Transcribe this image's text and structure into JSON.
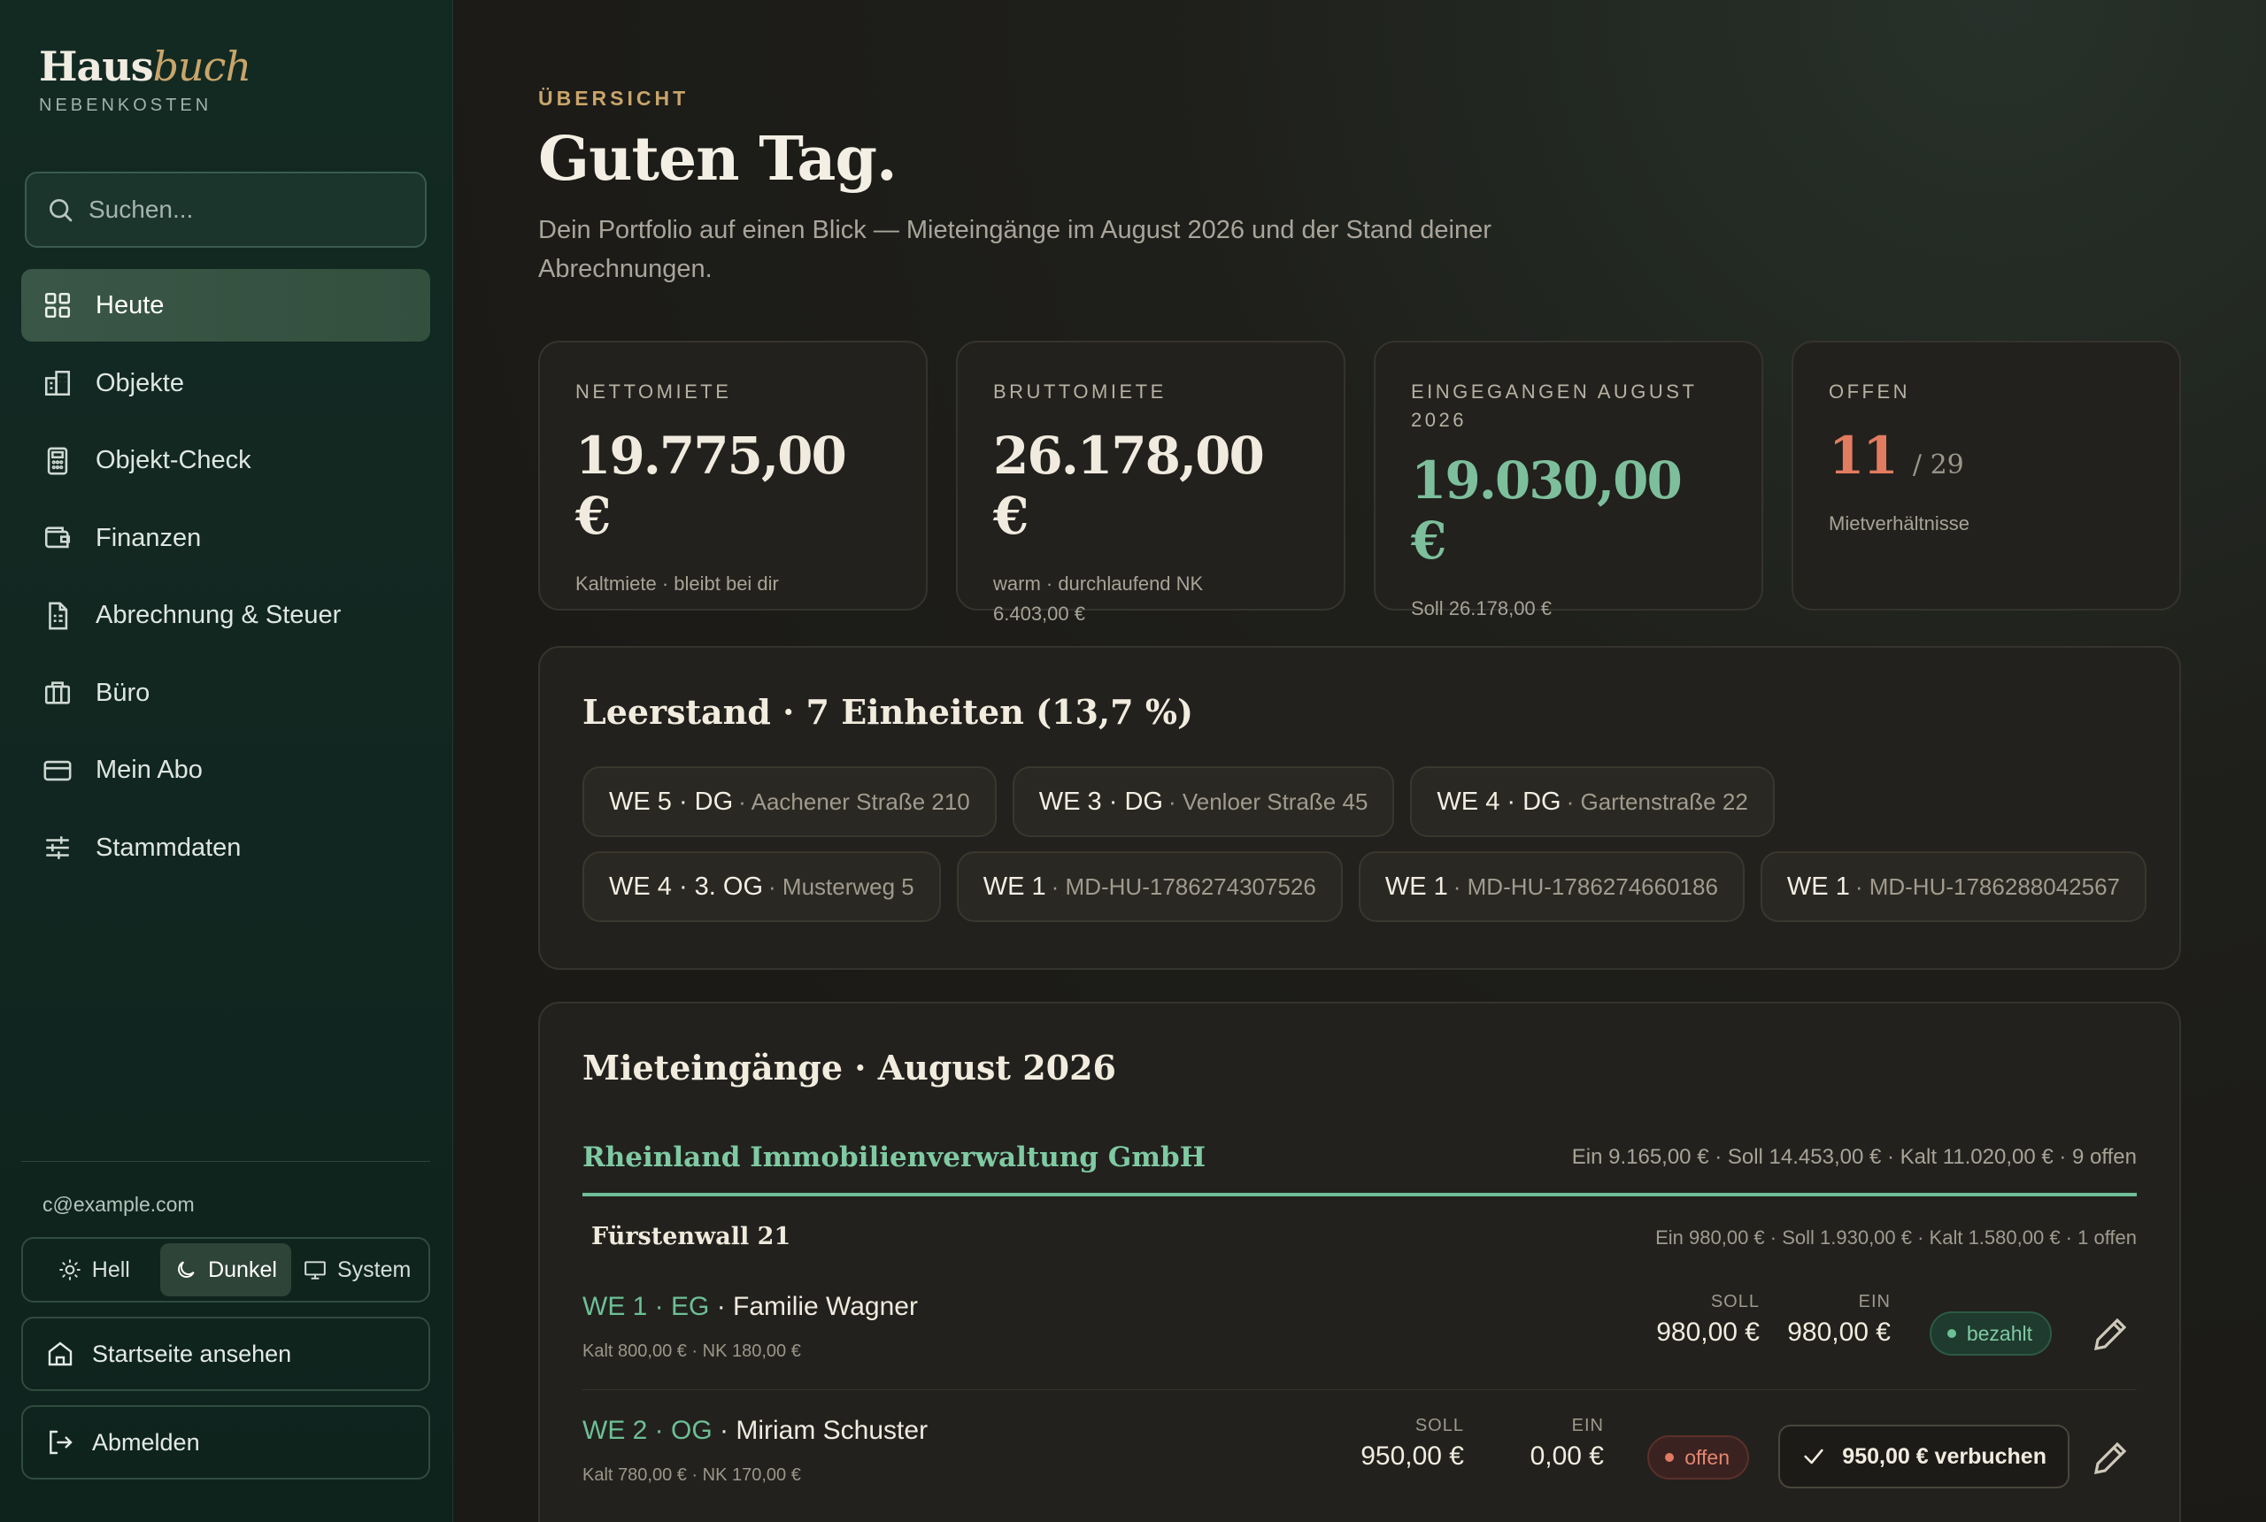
{
  "brand": {
    "title_main": "Haus",
    "title_accent": "buch",
    "subtitle": "NEBENKOSTEN"
  },
  "search": {
    "placeholder": "Suchen..."
  },
  "nav": [
    {
      "label": "Heute",
      "icon": "grid-icon",
      "active": true
    },
    {
      "label": "Objekte",
      "icon": "building-icon"
    },
    {
      "label": "Objekt-Check",
      "icon": "calculator-icon"
    },
    {
      "label": "Finanzen",
      "icon": "wallet-icon"
    },
    {
      "label": "Abrechnung & Steuer",
      "icon": "document-icon"
    },
    {
      "label": "Büro",
      "icon": "briefcase-icon"
    },
    {
      "label": "Mein Abo",
      "icon": "credit-card-icon"
    },
    {
      "label": "Stammdaten",
      "icon": "sliders-icon"
    }
  ],
  "user": {
    "email": "c@example.com"
  },
  "theme": {
    "light": "Hell",
    "dark": "Dunkel",
    "system": "System",
    "selected": "Dunkel"
  },
  "sidebar_actions": {
    "home": "Startseite ansehen",
    "logout": "Abmelden"
  },
  "header": {
    "eyebrow": "ÜBERSICHT",
    "title": "Guten Tag.",
    "lead": "Dein Portfolio auf einen Blick — Mieteingänge im August 2026 und der Stand deiner Abrechnungen."
  },
  "kpis": [
    {
      "label": "NETTOMIETE",
      "value": "19.775,00 €",
      "note": "Kaltmiete · bleibt bei dir"
    },
    {
      "label": "BRUTTOMIETE",
      "value": "26.178,00 €",
      "note": "warm · durchlaufend NK 6.403,00 €"
    },
    {
      "label": "EINGEGANGEN AUGUST 2026",
      "value": "19.030,00 €",
      "note": "Soll 26.178,00 €"
    },
    {
      "label": "OFFEN",
      "value": "11",
      "value_suffix": "/ 29",
      "note": "Mietverhältnisse"
    }
  ],
  "vacancy": {
    "title": "Leerstand · 7 Einheiten (13,7 %)",
    "chips": [
      {
        "unit": "WE 5 · DG",
        "addr": "· Aachener Straße 210"
      },
      {
        "unit": "WE 3 · DG",
        "addr": "· Venloer Straße 45"
      },
      {
        "unit": "WE 4 · DG",
        "addr": "· Gartenstraße 22"
      },
      {
        "unit": "WE 4 · 3. OG",
        "addr": "· Musterweg 5"
      },
      {
        "unit": "WE 1",
        "addr": "· MD-HU-1786274307526"
      },
      {
        "unit": "WE 1",
        "addr": "· MD-HU-1786274660186"
      },
      {
        "unit": "WE 1",
        "addr": "· MD-HU-1786288042567"
      }
    ]
  },
  "income": {
    "title": "Mieteingänge · August 2026",
    "landlord": {
      "name": "Rheinland Immobilienverwaltung GmbH",
      "stats": "Ein 9.165,00 € · Soll 14.453,00 € · Kalt 11.020,00 € · 9 offen"
    },
    "property": {
      "name": "Fürstenwall 21",
      "stats": "Ein 980,00 € · Soll 1.930,00 € · Kalt 1.580,00 € · 1 offen"
    },
    "labels": {
      "soll": "SOLL",
      "ein": "EIN"
    },
    "rows": [
      {
        "we": "WE 1 · EG",
        "tenant": "· Familie Wagner",
        "sub": "Kalt 800,00 € · NK 180,00 €",
        "soll": "980,00 €",
        "ein": "980,00 €",
        "status": "bezahlt"
      },
      {
        "we": "WE 2 · OG",
        "tenant": "· Miriam Schuster",
        "sub": "Kalt 780,00 € · NK 170,00 €",
        "soll": "950,00 €",
        "ein": "0,00 €",
        "status": "offen",
        "action": "950,00 € verbuchen"
      }
    ]
  },
  "colors": {
    "accent_gold": "#c9a56a",
    "accent_green": "#7dbf9c",
    "accent_red": "#e27c60",
    "sidebar_bg": "#132a23"
  }
}
